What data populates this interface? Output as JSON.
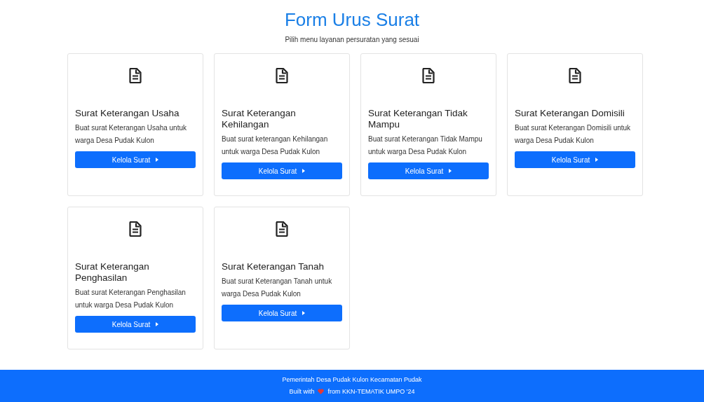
{
  "header": {
    "title": "Form Urus Surat",
    "subtitle": "Pilih menu layanan persuratan yang sesuai"
  },
  "cards": [
    {
      "title": "Surat Keterangan Usaha",
      "description": "Buat surat Keterangan Usaha untuk warga Desa Pudak Kulon",
      "button": "Kelola Surat"
    },
    {
      "title": "Surat Keterangan Kehilangan",
      "description": "Buat surat keterangan Kehilangan untuk warga Desa Pudak Kulon",
      "button": "Kelola Surat"
    },
    {
      "title": "Surat Keterangan Tidak Mampu",
      "description": "Buat surat Keterangan Tidak Mampu untuk warga Desa Pudak Kulon",
      "button": "Kelola Surat"
    },
    {
      "title": "Surat Keterangan Domisili",
      "description": "Buat surat Keterangan Domisili untuk warga Desa Pudak Kulon",
      "button": "Kelola Surat"
    },
    {
      "title": "Surat Keterangan Penghasilan",
      "description": "Buat surat Keterangan Penghasilan untuk warga Desa Pudak Kulon",
      "button": "Kelola Surat"
    },
    {
      "title": "Surat Keterangan Tanah",
      "description": "Buat surat Keterangan Tanah untuk warga Desa Pudak Kulon",
      "button": "Kelola Surat"
    }
  ],
  "footer": {
    "line_1": "Pemerintah Desa Pudak Kulon Kecamatan Pudak",
    "built_with": "Built with",
    "credit": "from KKN-TEMATIK UMPO '24"
  }
}
